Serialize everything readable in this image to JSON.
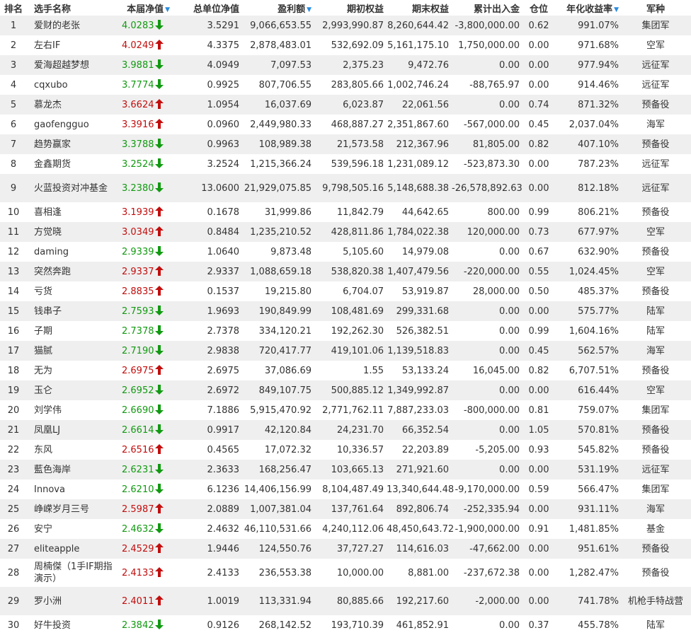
{
  "headers": {
    "rank": "排名",
    "name": "选手名称",
    "nav": "本届净值",
    "unit_nav": "总单位净值",
    "profit": "盈利额",
    "start_equity": "期初权益",
    "end_equity": "期末权益",
    "net_flow": "累计出入金",
    "position": "仓位",
    "annual_return": "年化收益率",
    "army": "军种"
  },
  "colors": {
    "up": "#c30d0d",
    "down": "#119a11",
    "sort_icon": "#2a8ce0",
    "odd_row": "#efefef"
  },
  "rows": [
    {
      "rank": "1",
      "name": "爱财的老张",
      "nav": "4.0283",
      "dir": "down",
      "unit_nav": "3.5291",
      "profit": "9,066,653.55",
      "start_equity": "2,993,990.87",
      "end_equity": "8,260,644.42",
      "net_flow": "-3,800,000.00",
      "position": "0.62",
      "annual_return": "991.07%",
      "army": "集团军"
    },
    {
      "rank": "2",
      "name": "左右IF",
      "nav": "4.0249",
      "dir": "up",
      "unit_nav": "4.3375",
      "profit": "2,878,483.01",
      "start_equity": "532,692.09",
      "end_equity": "5,161,175.10",
      "net_flow": "1,750,000.00",
      "position": "0.00",
      "annual_return": "971.68%",
      "army": "空军"
    },
    {
      "rank": "3",
      "name": "爱海超越梦想",
      "nav": "3.9881",
      "dir": "down",
      "unit_nav": "4.0949",
      "profit": "7,097.53",
      "start_equity": "2,375.23",
      "end_equity": "9,472.76",
      "net_flow": "0.00",
      "position": "0.00",
      "annual_return": "977.94%",
      "army": "远征军"
    },
    {
      "rank": "4",
      "name": "cqxubo",
      "nav": "3.7774",
      "dir": "down",
      "unit_nav": "0.9925",
      "profit": "807,706.55",
      "start_equity": "283,805.66",
      "end_equity": "1,002,746.24",
      "net_flow": "-88,765.97",
      "position": "0.00",
      "annual_return": "914.46%",
      "army": "远征军"
    },
    {
      "rank": "5",
      "name": "慕龙杰",
      "nav": "3.6624",
      "dir": "up",
      "unit_nav": "1.0954",
      "profit": "16,037.69",
      "start_equity": "6,023.87",
      "end_equity": "22,061.56",
      "net_flow": "0.00",
      "position": "0.74",
      "annual_return": "871.32%",
      "army": "预备役"
    },
    {
      "rank": "6",
      "name": "gaofengguo",
      "nav": "3.3916",
      "dir": "up",
      "unit_nav": "0.0960",
      "profit": "2,449,980.33",
      "start_equity": "468,887.27",
      "end_equity": "2,351,867.60",
      "net_flow": "-567,000.00",
      "position": "0.45",
      "annual_return": "2,037.04%",
      "army": "海军"
    },
    {
      "rank": "7",
      "name": "趋势赢家",
      "nav": "3.3788",
      "dir": "down",
      "unit_nav": "0.9963",
      "profit": "108,989.38",
      "start_equity": "21,573.58",
      "end_equity": "212,367.96",
      "net_flow": "81,805.00",
      "position": "0.82",
      "annual_return": "407.10%",
      "army": "预备役"
    },
    {
      "rank": "8",
      "name": "金鑫期货",
      "nav": "3.2524",
      "dir": "down",
      "unit_nav": "3.2524",
      "profit": "1,215,366.24",
      "start_equity": "539,596.18",
      "end_equity": "1,231,089.12",
      "net_flow": "-523,873.30",
      "position": "0.00",
      "annual_return": "787.23%",
      "army": "远征军"
    },
    {
      "rank": "9",
      "name": "火蓝投资对冲基金",
      "nav": "3.2380",
      "dir": "down",
      "unit_nav": "13.0600",
      "profit": "21,929,075.85",
      "start_equity": "9,798,505.16",
      "end_equity": "5,148,688.38",
      "net_flow": "-26,578,892.63",
      "position": "0.00",
      "annual_return": "812.18%",
      "army": "远征军"
    },
    {
      "rank": "10",
      "name": "喜相逢",
      "nav": "3.1939",
      "dir": "up",
      "unit_nav": "0.1678",
      "profit": "31,999.86",
      "start_equity": "11,842.79",
      "end_equity": "44,642.65",
      "net_flow": "800.00",
      "position": "0.99",
      "annual_return": "806.21%",
      "army": "预备役"
    },
    {
      "rank": "11",
      "name": "方觉晓",
      "nav": "3.0349",
      "dir": "up",
      "unit_nav": "0.8484",
      "profit": "1,235,210.52",
      "start_equity": "428,811.86",
      "end_equity": "1,784,022.38",
      "net_flow": "120,000.00",
      "position": "0.73",
      "annual_return": "677.97%",
      "army": "空军"
    },
    {
      "rank": "12",
      "name": "daming",
      "nav": "2.9339",
      "dir": "down",
      "unit_nav": "1.0640",
      "profit": "9,873.48",
      "start_equity": "5,105.60",
      "end_equity": "14,979.08",
      "net_flow": "0.00",
      "position": "0.67",
      "annual_return": "632.90%",
      "army": "预备役"
    },
    {
      "rank": "13",
      "name": "突然奔跑",
      "nav": "2.9337",
      "dir": "up",
      "unit_nav": "2.9337",
      "profit": "1,088,659.18",
      "start_equity": "538,820.38",
      "end_equity": "1,407,479.56",
      "net_flow": "-220,000.00",
      "position": "0.55",
      "annual_return": "1,024.45%",
      "army": "空军"
    },
    {
      "rank": "14",
      "name": "亏货",
      "nav": "2.8835",
      "dir": "up",
      "unit_nav": "0.1537",
      "profit": "19,215.80",
      "start_equity": "6,704.07",
      "end_equity": "53,919.87",
      "net_flow": "28,000.00",
      "position": "0.50",
      "annual_return": "485.37%",
      "army": "预备役"
    },
    {
      "rank": "15",
      "name": "钱串子",
      "nav": "2.7593",
      "dir": "down",
      "unit_nav": "1.9693",
      "profit": "190,849.99",
      "start_equity": "108,481.69",
      "end_equity": "299,331.68",
      "net_flow": "0.00",
      "position": "0.00",
      "annual_return": "575.77%",
      "army": "陆军"
    },
    {
      "rank": "16",
      "name": "子期",
      "nav": "2.7378",
      "dir": "down",
      "unit_nav": "2.7378",
      "profit": "334,120.21",
      "start_equity": "192,262.30",
      "end_equity": "526,382.51",
      "net_flow": "0.00",
      "position": "0.99",
      "annual_return": "1,604.16%",
      "army": "陆军"
    },
    {
      "rank": "17",
      "name": "猫腻",
      "nav": "2.7190",
      "dir": "down",
      "unit_nav": "2.9838",
      "profit": "720,417.77",
      "start_equity": "419,101.06",
      "end_equity": "1,139,518.83",
      "net_flow": "0.00",
      "position": "0.45",
      "annual_return": "562.57%",
      "army": "海军"
    },
    {
      "rank": "18",
      "name": "无为",
      "nav": "2.6975",
      "dir": "up",
      "unit_nav": "2.6975",
      "profit": "37,086.69",
      "start_equity": "1.55",
      "end_equity": "53,133.24",
      "net_flow": "16,045.00",
      "position": "0.82",
      "annual_return": "6,707.51%",
      "army": "预备役"
    },
    {
      "rank": "19",
      "name": "玉仑",
      "nav": "2.6952",
      "dir": "down",
      "unit_nav": "2.6972",
      "profit": "849,107.75",
      "start_equity": "500,885.12",
      "end_equity": "1,349,992.87",
      "net_flow": "0.00",
      "position": "0.00",
      "annual_return": "616.44%",
      "army": "空军"
    },
    {
      "rank": "20",
      "name": "刘学伟",
      "nav": "2.6690",
      "dir": "down",
      "unit_nav": "7.1886",
      "profit": "5,915,470.92",
      "start_equity": "2,771,762.11",
      "end_equity": "7,887,233.03",
      "net_flow": "-800,000.00",
      "position": "0.81",
      "annual_return": "759.07%",
      "army": "集团军"
    },
    {
      "rank": "21",
      "name": "凤凰LJ",
      "nav": "2.6614",
      "dir": "down",
      "unit_nav": "0.9917",
      "profit": "42,120.84",
      "start_equity": "24,231.70",
      "end_equity": "66,352.54",
      "net_flow": "0.00",
      "position": "1.05",
      "annual_return": "570.81%",
      "army": "预备役"
    },
    {
      "rank": "22",
      "name": "东风",
      "nav": "2.6516",
      "dir": "up",
      "unit_nav": "0.4565",
      "profit": "17,072.32",
      "start_equity": "10,336.57",
      "end_equity": "22,203.89",
      "net_flow": "-5,205.00",
      "position": "0.93",
      "annual_return": "545.82%",
      "army": "预备役"
    },
    {
      "rank": "23",
      "name": "藍色海岸",
      "nav": "2.6231",
      "dir": "down",
      "unit_nav": "2.3633",
      "profit": "168,256.47",
      "start_equity": "103,665.13",
      "end_equity": "271,921.60",
      "net_flow": "0.00",
      "position": "0.00",
      "annual_return": "531.19%",
      "army": "远征军"
    },
    {
      "rank": "24",
      "name": "Innova",
      "nav": "2.6210",
      "dir": "down",
      "unit_nav": "6.1236",
      "profit": "14,406,156.99",
      "start_equity": "8,104,487.49",
      "end_equity": "13,340,644.48",
      "net_flow": "-9,170,000.00",
      "position": "0.59",
      "annual_return": "566.47%",
      "army": "集团军"
    },
    {
      "rank": "25",
      "name": "峥嵘岁月三号",
      "nav": "2.5987",
      "dir": "up",
      "unit_nav": "2.0889",
      "profit": "1,007,381.04",
      "start_equity": "137,761.64",
      "end_equity": "892,806.74",
      "net_flow": "-252,335.94",
      "position": "0.00",
      "annual_return": "931.11%",
      "army": "海军"
    },
    {
      "rank": "26",
      "name": "安宁",
      "nav": "2.4632",
      "dir": "down",
      "unit_nav": "2.4632",
      "profit": "46,110,531.66",
      "start_equity": "4,240,112.06",
      "end_equity": "48,450,643.72",
      "net_flow": "-1,900,000.00",
      "position": "0.91",
      "annual_return": "1,481.85%",
      "army": "基金"
    },
    {
      "rank": "27",
      "name": "eliteapple",
      "nav": "2.4529",
      "dir": "up",
      "unit_nav": "1.9446",
      "profit": "124,550.76",
      "start_equity": "37,727.27",
      "end_equity": "114,616.03",
      "net_flow": "-47,662.00",
      "position": "0.00",
      "annual_return": "951.61%",
      "army": "预备役"
    },
    {
      "rank": "28",
      "name": "周楠傑（1手IF期指演示）",
      "nav": "2.4133",
      "dir": "up",
      "unit_nav": "2.4133",
      "profit": "236,553.38",
      "start_equity": "10,000.00",
      "end_equity": "8,881.00",
      "net_flow": "-237,672.38",
      "position": "0.00",
      "annual_return": "1,282.47%",
      "army": "预备役"
    },
    {
      "rank": "29",
      "name": "罗小洲",
      "nav": "2.4011",
      "dir": "up",
      "unit_nav": "1.0019",
      "profit": "113,331.94",
      "start_equity": "80,885.66",
      "end_equity": "192,217.60",
      "net_flow": "-2,000.00",
      "position": "0.00",
      "annual_return": "741.78%",
      "army": "机枪手特战营"
    },
    {
      "rank": "30",
      "name": "好牛投资",
      "nav": "2.3842",
      "dir": "down",
      "unit_nav": "0.9126",
      "profit": "268,142.52",
      "start_equity": "193,710.39",
      "end_equity": "461,852.91",
      "net_flow": "0.00",
      "position": "0.37",
      "annual_return": "455.78%",
      "army": "陆军"
    }
  ]
}
